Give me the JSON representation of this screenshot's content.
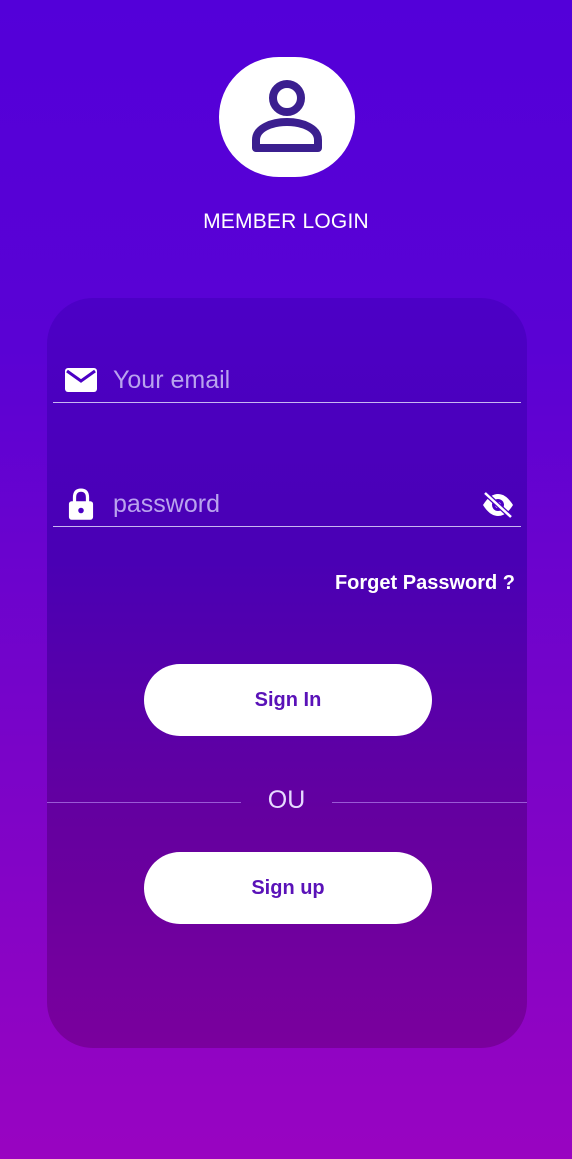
{
  "header": {
    "title": "MEMBER LOGIN",
    "avatar_icon": "user-icon"
  },
  "form": {
    "email": {
      "placeholder": "Your email",
      "icon": "mail-icon"
    },
    "password": {
      "placeholder": "password",
      "icon": "lock-icon",
      "toggle_icon": "eye-off-icon"
    },
    "forget_label": "Forget Password ?",
    "signin_label": "Sign In",
    "separator_label": "OU",
    "signup_label": "Sign up"
  },
  "colors": {
    "background_top": "#5300d9",
    "background_bottom": "#9904c1",
    "button_text": "#5a12b8",
    "placeholder": "#b9a3ee"
  }
}
